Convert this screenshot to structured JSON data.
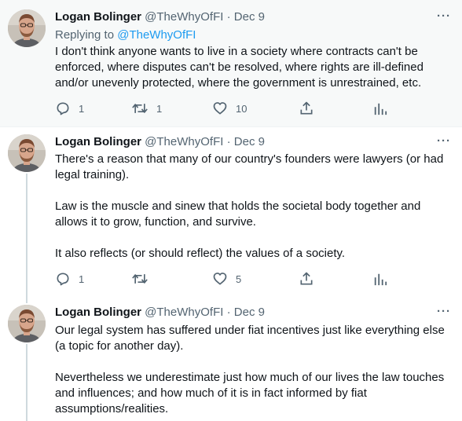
{
  "tweets": [
    {
      "name": "Logan Bolinger",
      "handle": "@TheWhyOfFI",
      "separator": "·",
      "date": "Dec 9",
      "more": "···",
      "replying_prefix": "Replying to",
      "replying_handle": "@TheWhyOfFI",
      "paragraphs": [
        "I don't think anyone wants to live in a society where contracts can't be enforced, where disputes can't be resolved, where rights are ill-defined and/or unevenly protected, where the government is unrestrained, etc."
      ],
      "reply_count": "1",
      "retweet_count": "1",
      "like_count": "10"
    },
    {
      "name": "Logan Bolinger",
      "handle": "@TheWhyOfFI",
      "separator": "·",
      "date": "Dec 9",
      "more": "···",
      "paragraphs": [
        "There's a reason that many of our country's founders were lawyers (or had legal training).",
        "Law is the muscle and sinew that holds the societal body together and allows it to grow, function, and survive.",
        "It also reflects (or should reflect) the values of a society."
      ],
      "reply_count": "1",
      "retweet_count": "",
      "like_count": "5"
    },
    {
      "name": "Logan Bolinger",
      "handle": "@TheWhyOfFI",
      "separator": "·",
      "date": "Dec 9",
      "more": "···",
      "paragraphs": [
        "Our legal system has suffered under fiat incentives just like everything else (a topic for another day).",
        "Nevertheless we underestimate just how much of our lives the law touches and influences; and how much of it is in fact informed by fiat assumptions/realities."
      ]
    }
  ],
  "icons": {
    "reply": "reply-icon",
    "retweet": "retweet-icon",
    "like": "heart-icon",
    "share": "share-icon",
    "analytics": "analytics-icon"
  },
  "colors": {
    "link": "#1d9bf0",
    "secondary_text": "#536471",
    "highlight_background": "#f7f9f9",
    "thread_line": "#cfd9de"
  }
}
